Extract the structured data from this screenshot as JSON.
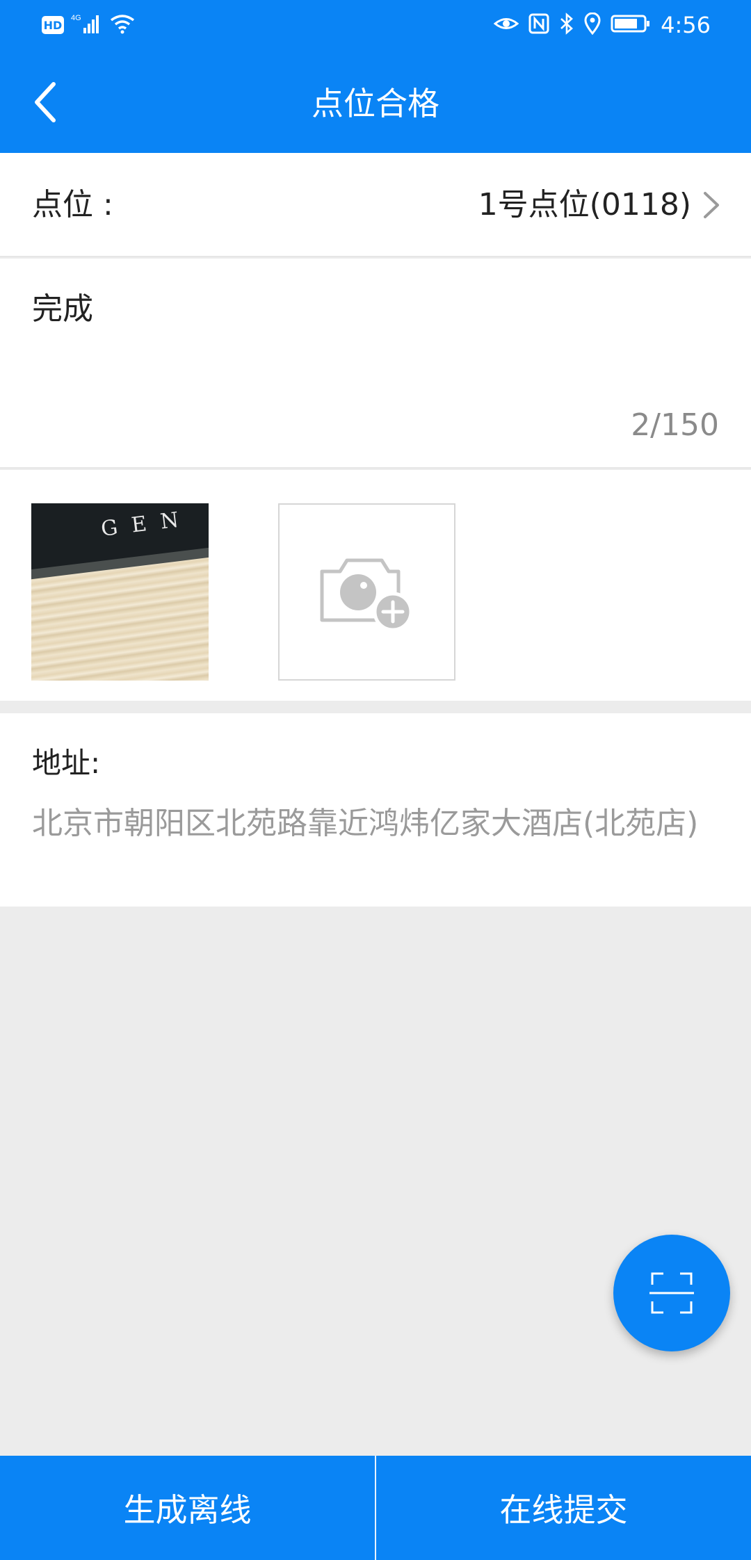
{
  "status_bar": {
    "left_badge": "HD",
    "network": "4G",
    "time": "4:56",
    "icons": [
      "hd-icon",
      "signal-icon",
      "wifi-icon",
      "eye-icon",
      "nfc-icon",
      "bluetooth-icon",
      "location-icon",
      "battery-icon"
    ]
  },
  "nav": {
    "title": "点位合格",
    "back_icon": "chevron-left-icon"
  },
  "point_row": {
    "label": "点位 :",
    "value": "1号点位(0118)",
    "chevron_icon": "chevron-right-icon"
  },
  "remark": {
    "text": "完成",
    "counter": "2/150"
  },
  "photos": {
    "thumbnail_caption": "GEN",
    "add_icon": "camera-add-icon"
  },
  "address": {
    "label": "地址:",
    "value": "北京市朝阳区北苑路靠近鸿炜亿家大酒店(北苑店)"
  },
  "fab": {
    "icon": "scan-icon"
  },
  "bottom": {
    "left_label": "生成离线",
    "right_label": "在线提交"
  },
  "colors": {
    "primary": "#0a84f5",
    "background": "#ececec",
    "text": "#222222",
    "muted": "#9a9a9a"
  }
}
